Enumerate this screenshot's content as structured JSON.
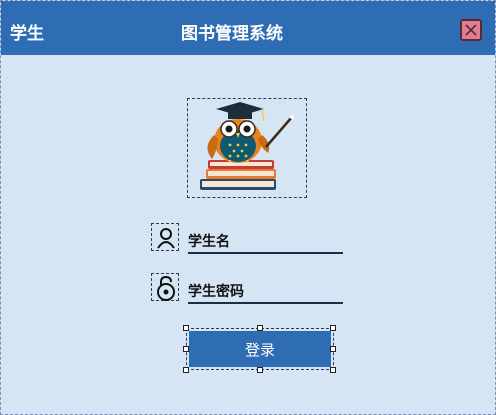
{
  "titlebar": {
    "role_label": "学生",
    "app_title": "图书管理系统",
    "close_icon": "close-icon",
    "background": "#2e6db3",
    "close_color": "#e07d94"
  },
  "logo": {
    "icon": "owl-teacher-books-logo"
  },
  "form": {
    "username": {
      "placeholder": "学生名",
      "icon": "user-icon"
    },
    "password": {
      "placeholder": "学生密码",
      "icon": "lock-icon"
    },
    "login_label": "登录"
  },
  "colors": {
    "window_bg": "#d6e5f3",
    "accent": "#2e6db3"
  }
}
